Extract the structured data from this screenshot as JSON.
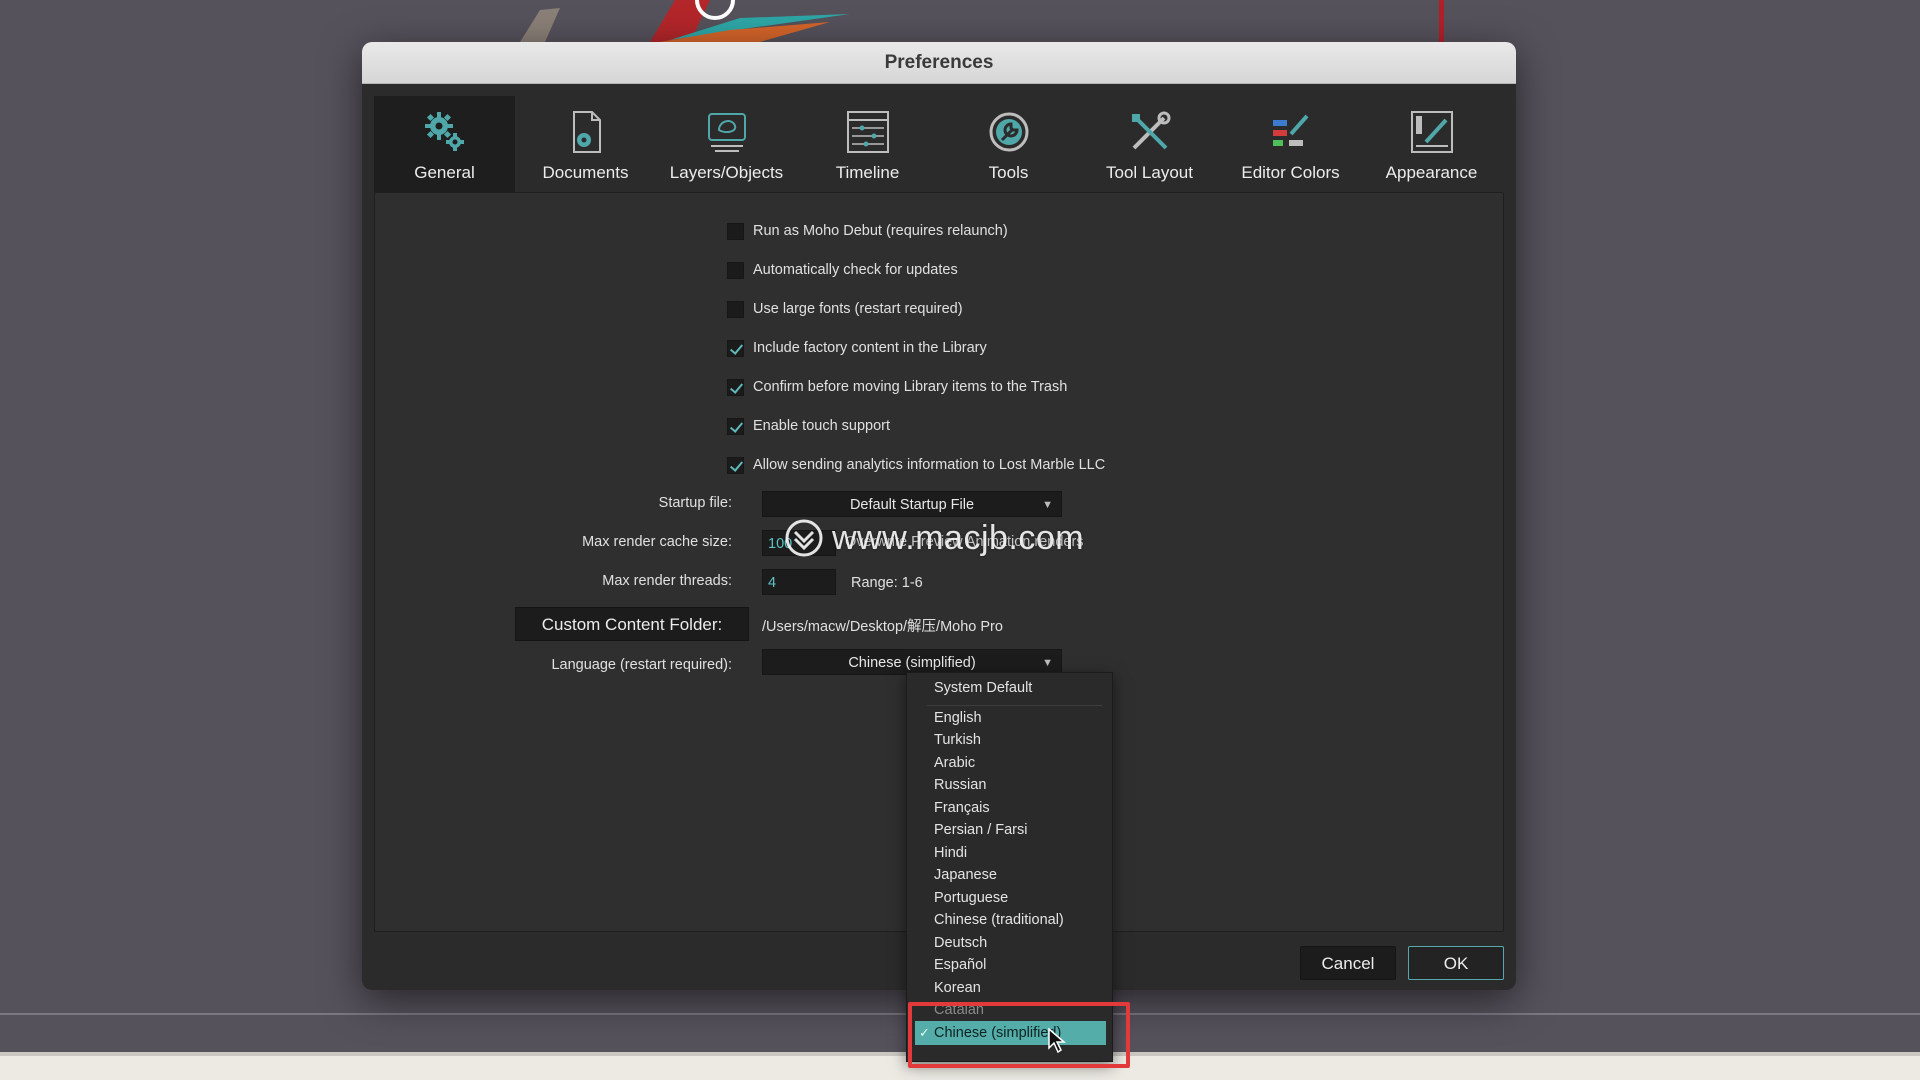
{
  "window": {
    "title": "Preferences"
  },
  "tabs": [
    {
      "label": "General",
      "icon": "gears-icon",
      "active": true
    },
    {
      "label": "Documents",
      "icon": "document-gear-icon"
    },
    {
      "label": "Layers/Objects",
      "icon": "layers-icon"
    },
    {
      "label": "Timeline",
      "icon": "timeline-icon"
    },
    {
      "label": "Tools",
      "icon": "wrench-icon"
    },
    {
      "label": "Tool Layout",
      "icon": "tools-cross-icon"
    },
    {
      "label": "Editor Colors",
      "icon": "color-bars-icon"
    },
    {
      "label": "Appearance",
      "icon": "pen-frame-icon"
    }
  ],
  "checkboxes": [
    {
      "label": "Run as Moho Debut (requires relaunch)",
      "checked": false
    },
    {
      "label": "Automatically check for updates",
      "checked": false
    },
    {
      "label": "Use large fonts (restart required)",
      "checked": false
    },
    {
      "label": "Include factory content in the Library",
      "checked": true
    },
    {
      "label": "Confirm before moving Library items to the Trash",
      "checked": true
    },
    {
      "label": "Enable touch support",
      "checked": true
    },
    {
      "label": "Allow sending analytics information to Lost Marble LLC",
      "checked": true
    }
  ],
  "fields": {
    "startup_label": "Startup file:",
    "startup_value": "Default Startup File",
    "cache_label": "Max render cache size:",
    "cache_value": "100",
    "cache_note": "Overwrite Preview Animation renders",
    "threads_label": "Max render threads:",
    "threads_value": "4",
    "threads_range": "Range: 1-6",
    "custom_folder_button": "Custom Content Folder:",
    "custom_folder_path": "/Users/macw/Desktop/解压/Moho Pro",
    "language_label": "Language (restart required):",
    "language_value": "Chinese (simplified)"
  },
  "buttons": {
    "cancel": "Cancel",
    "ok": "OK"
  },
  "watermark": "www.macjb.com",
  "language_menu": {
    "default_item": "System Default",
    "items": [
      "English",
      "Turkish",
      "Arabic",
      "Russian",
      "Français",
      "Persian / Farsi",
      "Hindi",
      "Japanese",
      "Portuguese",
      "Chinese (traditional)",
      "Deutsch",
      "Español",
      "Korean"
    ],
    "faded_item": "Catalan",
    "selected_item": "Chinese (simplified)",
    "check_mark": "✓"
  },
  "colors": {
    "accent": "#54ada8",
    "highlight_box": "#e23a3a"
  }
}
